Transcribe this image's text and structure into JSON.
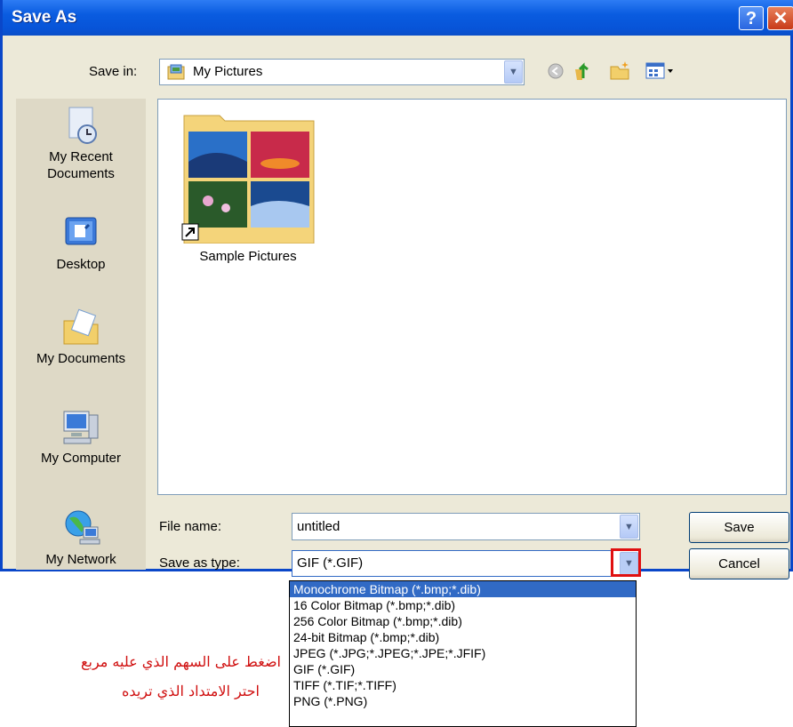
{
  "window": {
    "title": "Save As",
    "help_glyph": "?",
    "close_glyph": "✕"
  },
  "toolbar": {
    "save_in_label": "Save in:",
    "save_in_value": "My Pictures"
  },
  "places": [
    {
      "label": "My Recent Documents",
      "icon": "recent-documents-icon"
    },
    {
      "label": "Desktop",
      "icon": "desktop-icon"
    },
    {
      "label": "My Documents",
      "icon": "my-documents-icon"
    },
    {
      "label": "My Computer",
      "icon": "my-computer-icon"
    },
    {
      "label": "My Network",
      "icon": "my-network-icon"
    }
  ],
  "files": [
    {
      "name": "Sample Pictures",
      "icon": "folder-shortcut-icon"
    }
  ],
  "form": {
    "file_name_label": "File name:",
    "file_name_value": "untitled",
    "save_as_type_label": "Save as type:",
    "save_as_type_value": "GIF (*.GIF)"
  },
  "buttons": {
    "save": "Save",
    "cancel": "Cancel"
  },
  "type_options": [
    "Monochrome Bitmap (*.bmp;*.dib)",
    "16 Color Bitmap (*.bmp;*.dib)",
    "256 Color Bitmap (*.bmp;*.dib)",
    "24-bit Bitmap (*.bmp;*.dib)",
    "JPEG (*.JPG;*.JPEG;*.JPE;*.JFIF)",
    "GIF (*.GIF)",
    "TIFF (*.TIF;*.TIFF)",
    "PNG (*.PNG)"
  ],
  "selected_option_index": 0,
  "annotation": {
    "line1": "اضغط على السهم الذي عليه مربع",
    "line2": "احتر الامتداد الذي تريده"
  },
  "colors": {
    "title_bar": "#0a5ce0",
    "highlight": "#316ac5",
    "annotation": "#d01010",
    "marker": "#e01010"
  }
}
